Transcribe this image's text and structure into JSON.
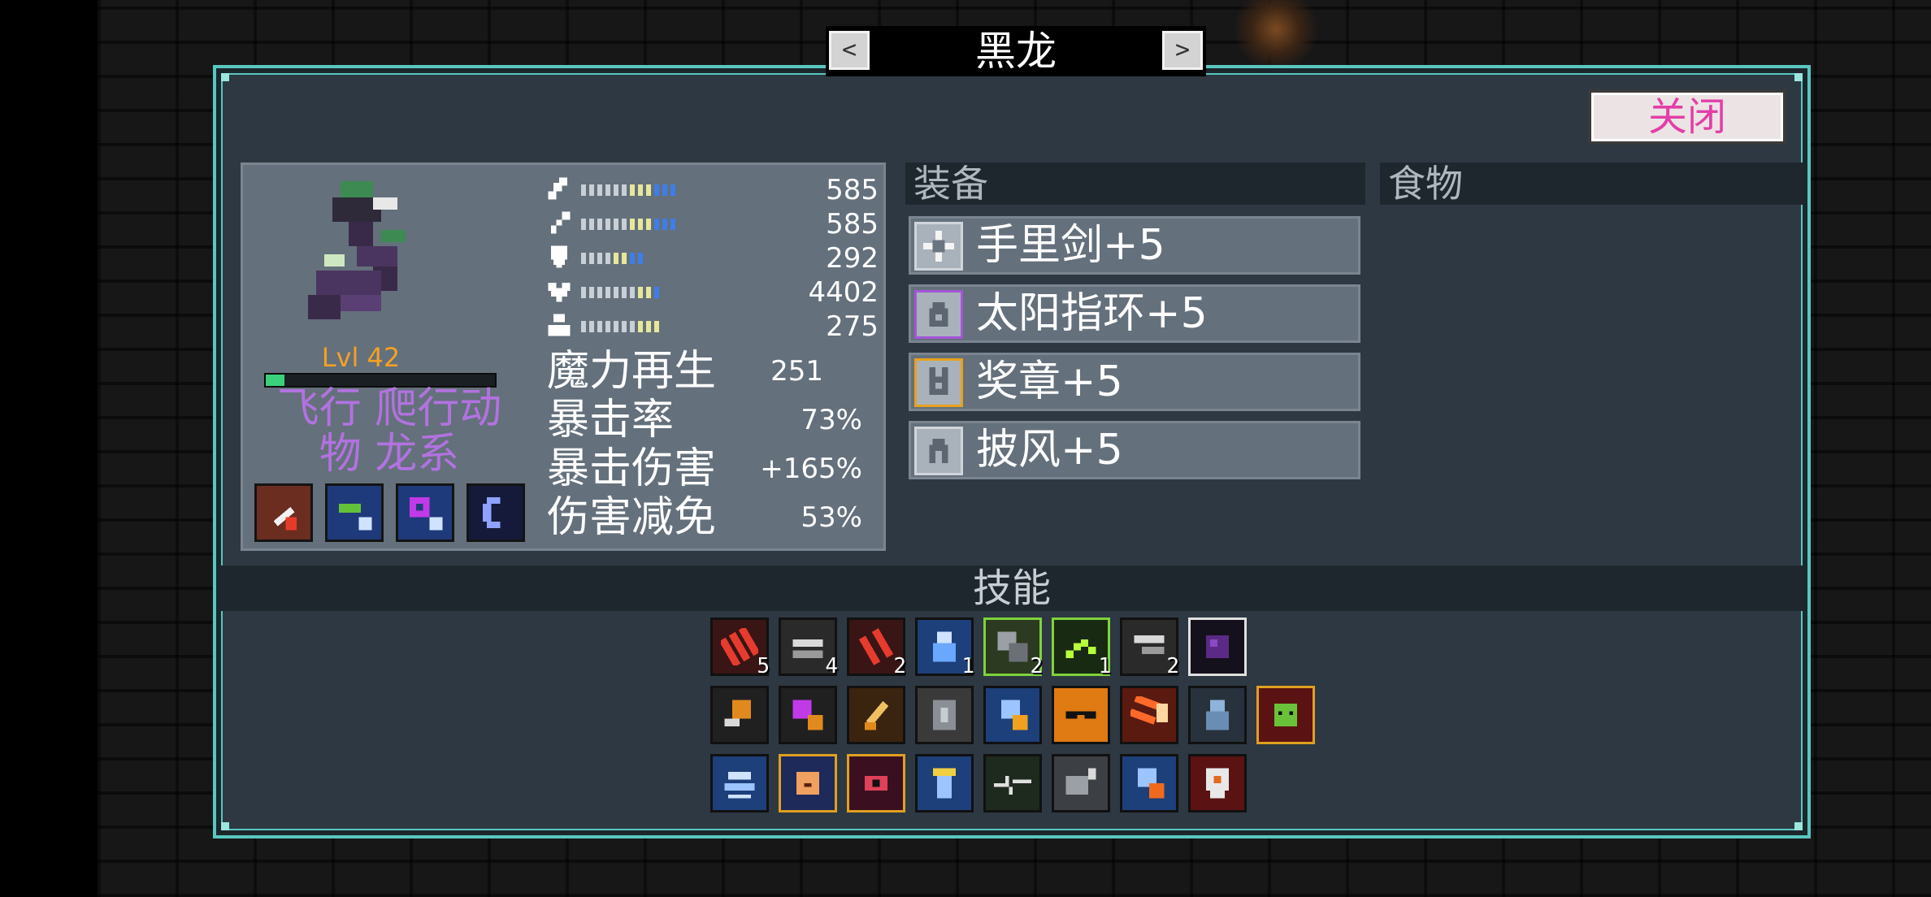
{
  "header": {
    "title": "黑龙",
    "prev_label": "<",
    "next_label": ">",
    "close_label": "关闭"
  },
  "monster": {
    "level_label": "Lvl 42",
    "exp_fraction": 0.08,
    "types_line1": "飞行 爬行动",
    "types_line2": "物 龙系",
    "stats": [
      {
        "icon": "sword-icon",
        "value": "585"
      },
      {
        "icon": "staff-icon",
        "value": "585"
      },
      {
        "icon": "shield-icon",
        "value": "292"
      },
      {
        "icon": "heart-icon",
        "value": "4402"
      },
      {
        "icon": "speed-icon",
        "value": "275"
      }
    ],
    "attributes": [
      {
        "label": "魔力再生",
        "value": "251"
      },
      {
        "label": "暴击率",
        "value": "73%"
      },
      {
        "label": "暴击伤害",
        "value": "+165%"
      },
      {
        "label": "伤害减免",
        "value": "53%"
      }
    ]
  },
  "equipment": {
    "heading": "装备",
    "items": [
      {
        "name": "手里剑+5",
        "icon": "shuriken-icon",
        "border": "#cfd5db"
      },
      {
        "name": "太阳指环+5",
        "icon": "ring-icon",
        "border": "#a455d8"
      },
      {
        "name": "奖章+5",
        "icon": "medal-icon",
        "border": "#e8a21d"
      },
      {
        "name": "披风+5",
        "icon": "cape-icon",
        "border": "#cfd5db"
      }
    ]
  },
  "food": {
    "heading": "食物"
  },
  "skills": {
    "heading": "技能",
    "row1_counts": [
      "5",
      "4",
      "2",
      "1",
      "2",
      "1",
      "2",
      ""
    ]
  },
  "colors": {
    "panel_border": "#58c7bf",
    "close_text": "#e23fa8",
    "level_text": "#f3a125",
    "types_text": "#b272e0"
  }
}
